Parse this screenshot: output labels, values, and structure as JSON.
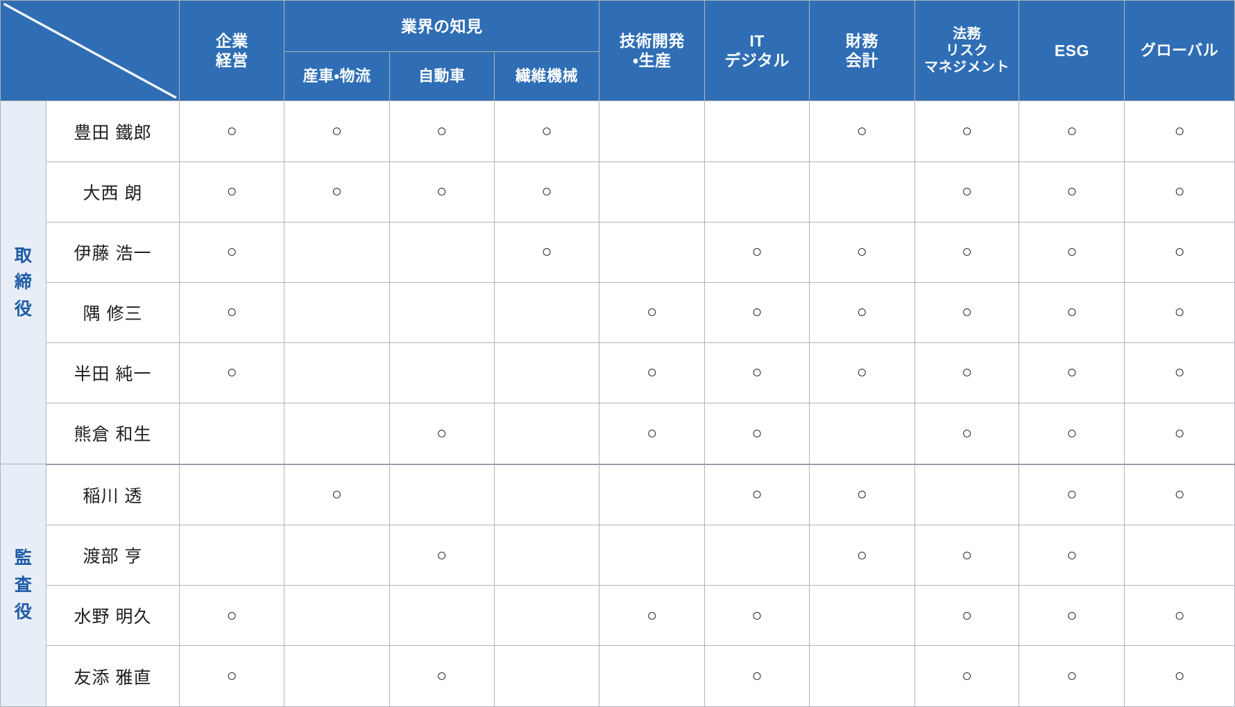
{
  "matrix": {
    "corner": {
      "icon": "diagonal-slash",
      "label": ""
    },
    "column_groups": [
      {
        "label": "",
        "span": 1,
        "leaf": true,
        "key": "corp_management"
      },
      {
        "label": "業界の知見",
        "span": 3,
        "leaf": false,
        "key": "industry_knowledge"
      },
      {
        "label": "",
        "span": 1,
        "leaf": true,
        "key": "rnd_production"
      },
      {
        "label": "",
        "span": 1,
        "leaf": true,
        "key": "it_digital"
      },
      {
        "label": "",
        "span": 1,
        "leaf": true,
        "key": "finance_accounting"
      },
      {
        "label": "",
        "span": 1,
        "leaf": true,
        "key": "legal_risk"
      },
      {
        "label": "",
        "span": 1,
        "leaf": true,
        "key": "esg"
      },
      {
        "label": "",
        "span": 1,
        "leaf": true,
        "key": "global"
      }
    ],
    "columns": [
      {
        "key": "corp_management",
        "label": "企業\n経営",
        "lines": [
          "企業",
          "経営"
        ]
      },
      {
        "key": "industrial_logistics",
        "label": "産車・物流",
        "lines": [
          "産車・物流"
        ]
      },
      {
        "key": "automotive",
        "label": "自動車",
        "lines": [
          "自動車"
        ]
      },
      {
        "key": "textile_machinery",
        "label": "繊維機械",
        "lines": [
          "繊維機械"
        ]
      },
      {
        "key": "rnd_production",
        "label": "技術開発・生産",
        "lines": [
          "技術開発",
          "・生産"
        ]
      },
      {
        "key": "it_digital",
        "label": "ITデジタル",
        "lines": [
          "IT",
          "デジタル"
        ]
      },
      {
        "key": "finance_accounting",
        "label": "財務会計",
        "lines": [
          "財務",
          "会計"
        ]
      },
      {
        "key": "legal_risk",
        "label": "法務リスクマネジメント",
        "lines": [
          "法務",
          "リスク",
          "マネジメント"
        ]
      },
      {
        "key": "esg",
        "label": "ESG",
        "lines": [
          "ESG"
        ]
      },
      {
        "key": "global",
        "label": "グローバル",
        "lines": [
          "グローバル"
        ]
      }
    ],
    "industry_group_label": "業界の知見",
    "mark_symbol": "○",
    "role_groups": [
      {
        "label": "取締役",
        "label_chars": [
          "取",
          "締",
          "役"
        ],
        "rows": [
          {
            "name": "豊田 鐵郎",
            "marks": [
              true,
              true,
              true,
              true,
              false,
              false,
              true,
              true,
              true,
              true
            ]
          },
          {
            "name": "大西 朗",
            "marks": [
              true,
              true,
              true,
              true,
              false,
              false,
              false,
              true,
              true,
              true
            ]
          },
          {
            "name": "伊藤 浩一",
            "marks": [
              true,
              false,
              false,
              true,
              false,
              true,
              true,
              true,
              true,
              true
            ]
          },
          {
            "name": "隅 修三",
            "marks": [
              true,
              false,
              false,
              false,
              true,
              true,
              true,
              true,
              true,
              true
            ]
          },
          {
            "name": "半田 純一",
            "marks": [
              true,
              false,
              false,
              false,
              true,
              true,
              true,
              true,
              true,
              true
            ]
          },
          {
            "name": "熊倉 和生",
            "marks": [
              false,
              false,
              true,
              false,
              true,
              true,
              false,
              true,
              true,
              true
            ]
          }
        ]
      },
      {
        "label": "監査役",
        "label_chars": [
          "監",
          "査",
          "役"
        ],
        "rows": [
          {
            "name": "稲川 透",
            "marks": [
              false,
              true,
              false,
              false,
              false,
              true,
              true,
              false,
              true,
              true
            ]
          },
          {
            "name": "渡部 亨",
            "marks": [
              false,
              false,
              true,
              false,
              false,
              false,
              true,
              true,
              true,
              false
            ]
          },
          {
            "name": "水野 明久",
            "marks": [
              true,
              false,
              false,
              false,
              true,
              true,
              false,
              true,
              true,
              true
            ]
          },
          {
            "name": "友添 雅直",
            "marks": [
              true,
              false,
              true,
              false,
              false,
              true,
              false,
              true,
              true,
              true
            ]
          }
        ]
      }
    ]
  },
  "colors": {
    "header_blue": "#2F6EB5",
    "group_label_bg": "#E8EEF7",
    "group_label_text": "#1F5BA6",
    "grid_line": "#AEB4BA",
    "cell_bg": "#FFFFFF",
    "mark_color": "#222222"
  }
}
